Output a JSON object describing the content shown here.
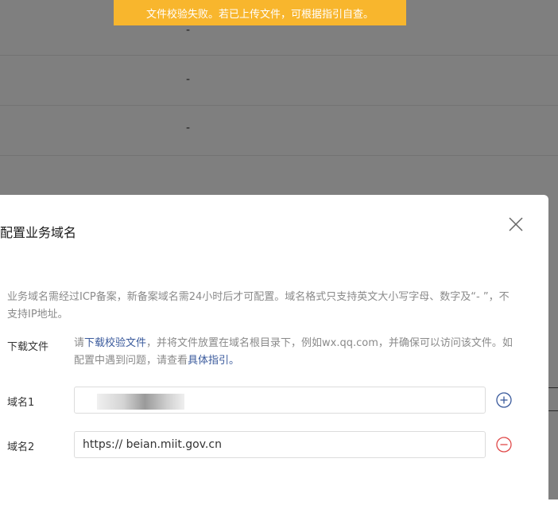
{
  "toast": {
    "message": "文件校验失败。若已上传文件，可根据指引自查。"
  },
  "background": {
    "rows": [
      "-",
      "-",
      "-"
    ]
  },
  "dialog": {
    "title": "配置业务域名",
    "notice": "业务域名需经过ICP备案，新备案域名需24小时后才可配置。域名格式只支持英文大小写字母、数字及“- ”，不支持IP地址。",
    "download": {
      "label": "下载文件",
      "text_prefix": "请",
      "link_download": "下载校验文件",
      "text_middle": "，并将文件放置在域名根目录下，例如wx.qq.com，并确保可以访问该文件。如配置中遇到问题，请查看",
      "link_guide": "具体指引",
      "text_suffix": "。"
    },
    "domain1": {
      "label": "域名1",
      "value": ""
    },
    "domain2": {
      "label": "域名2",
      "value": "https:// beian.miit.gov.cn"
    }
  },
  "colors": {
    "toast_bg": "#f8b62d",
    "link": "#3a5a9c",
    "add_icon": "#3a5a9c",
    "remove_icon": "#e04a4a"
  },
  "icons": {
    "close": "close-icon",
    "add": "plus-circle-icon",
    "remove": "minus-circle-icon"
  }
}
